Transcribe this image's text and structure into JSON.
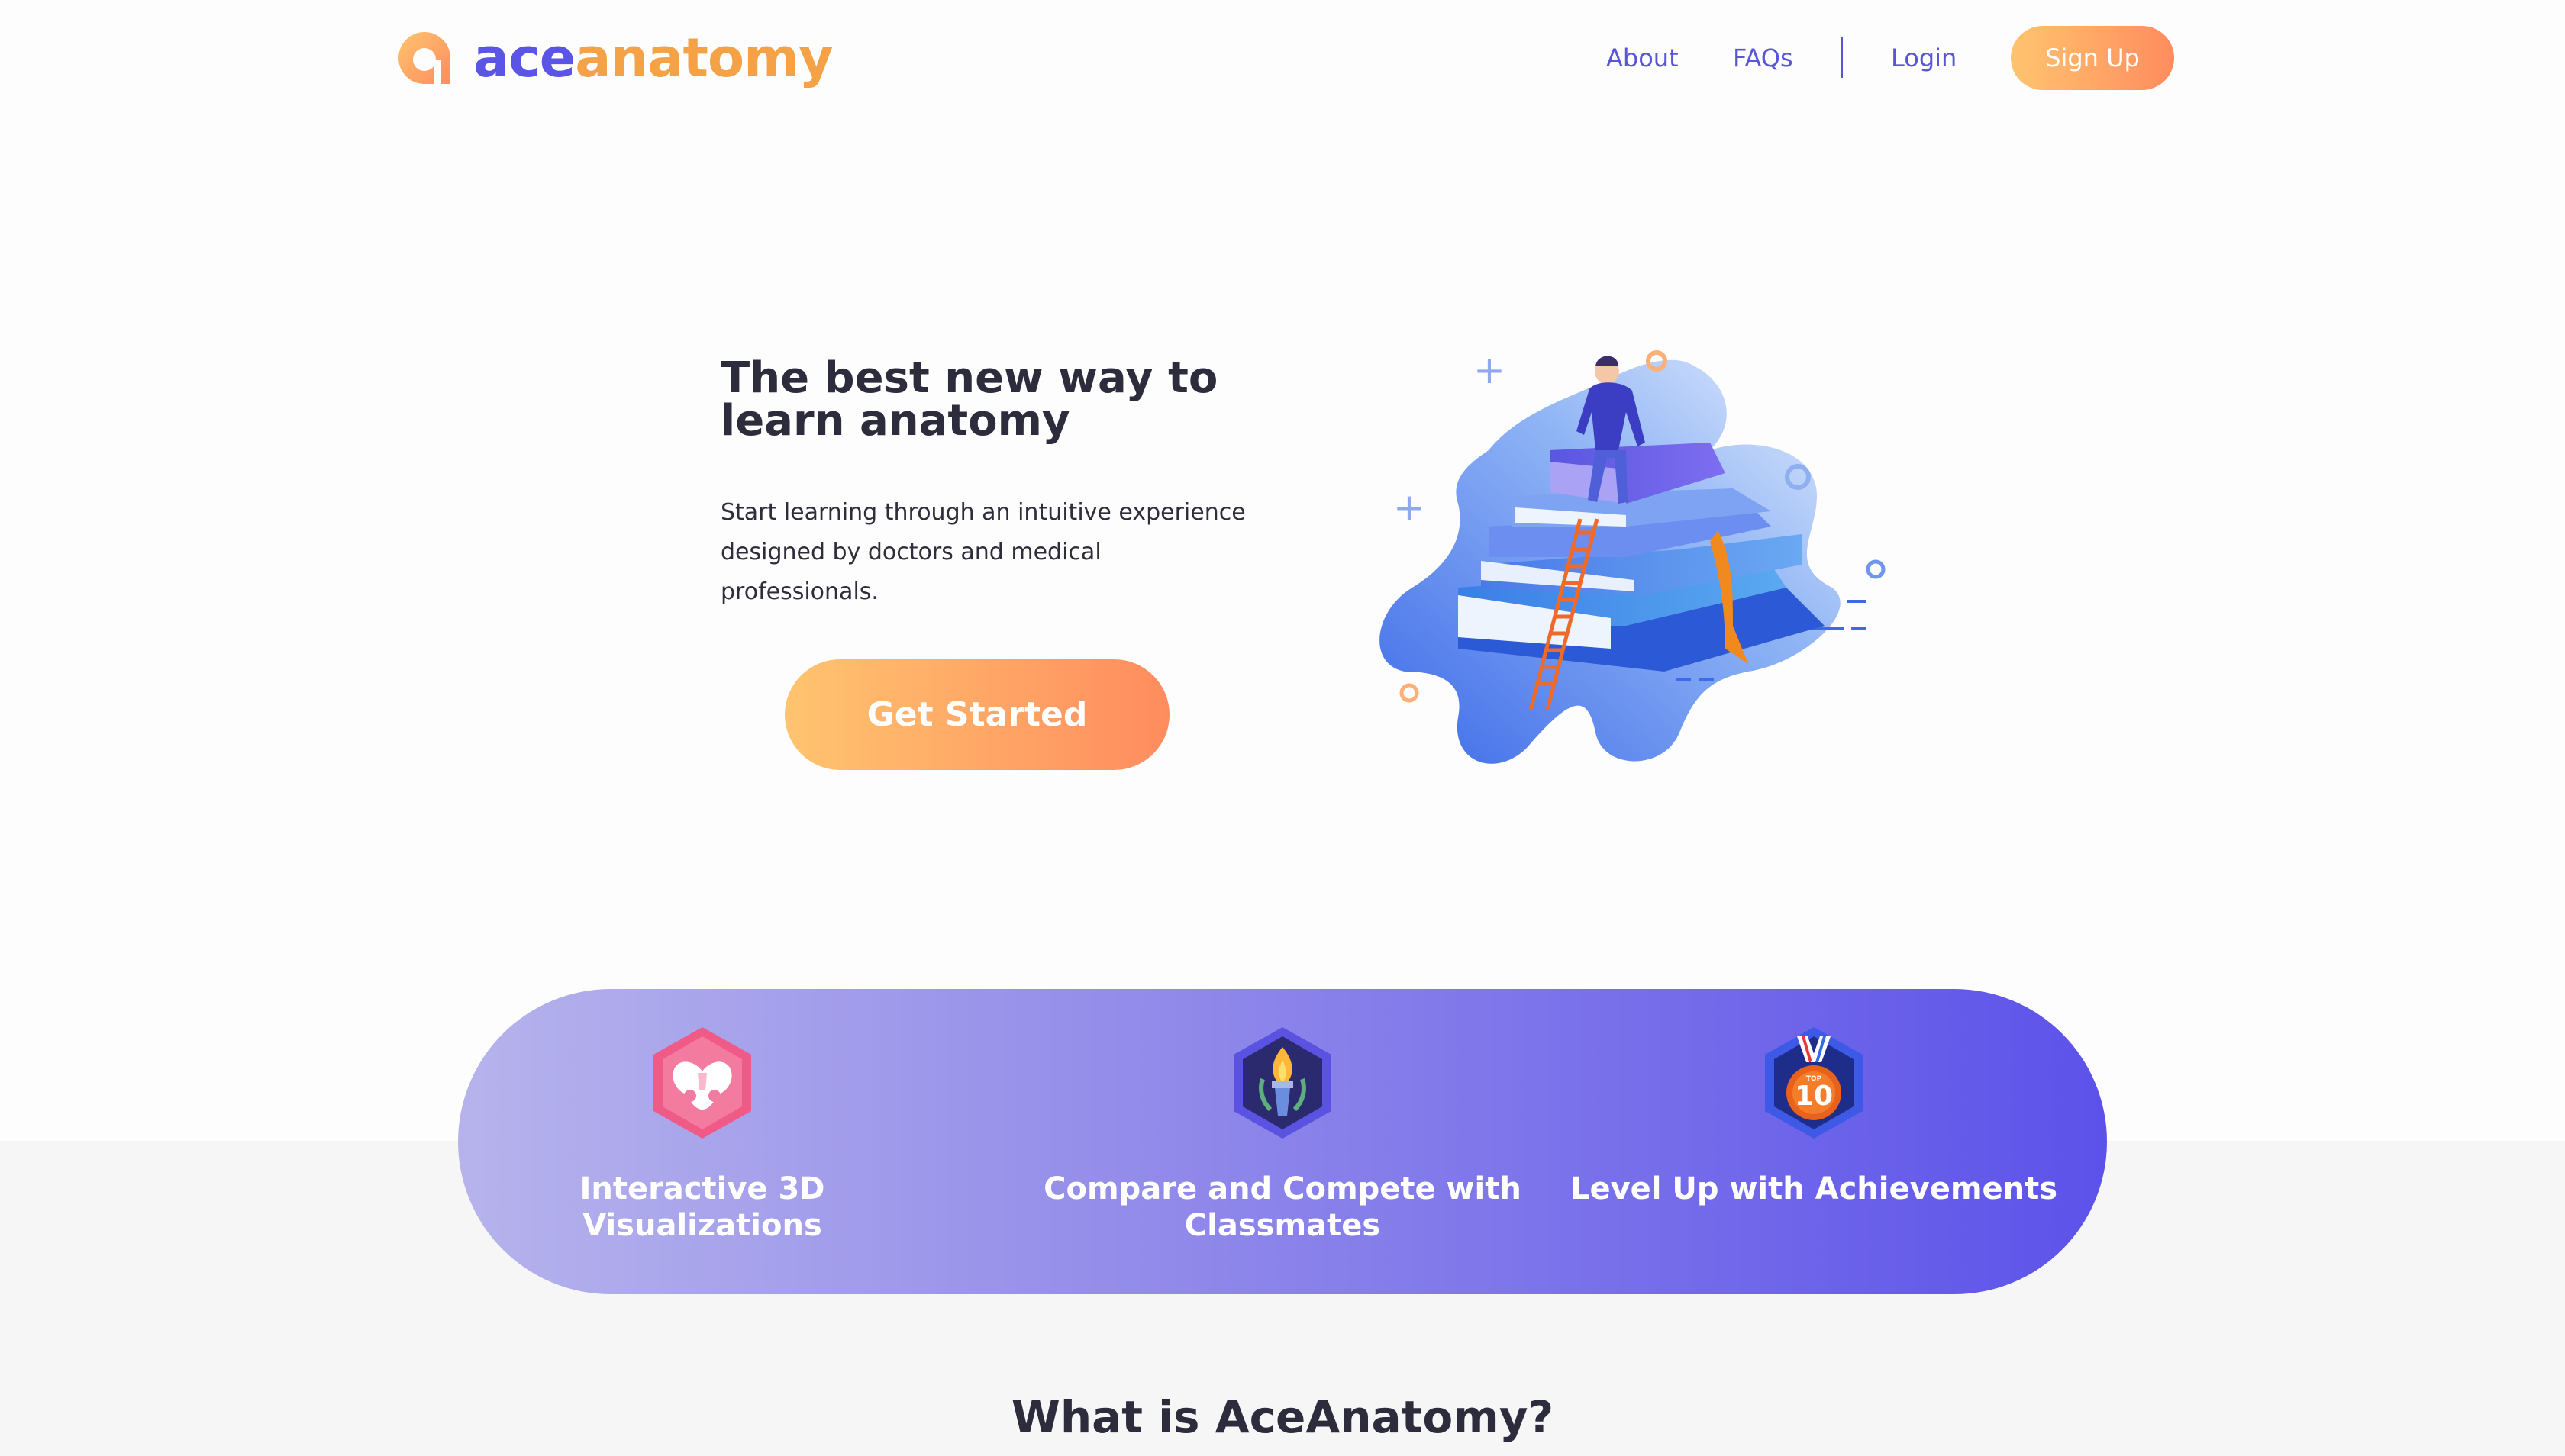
{
  "brand": {
    "name_part1": "ace",
    "name_part2": "anatomy",
    "primary_color": "#5a55e6",
    "accent_color": "#f5a247"
  },
  "nav": {
    "about": "About",
    "faqs": "FAQs",
    "login": "Login",
    "signup": "Sign Up"
  },
  "hero": {
    "title": "The best new way to learn anatomy",
    "subtitle": "Start learning through an intuitive experience designed by doctors and medical professionals.",
    "cta": "Get Started"
  },
  "features": [
    {
      "icon": "pelvis-badge-icon",
      "label": "Interactive 3D Visualizations"
    },
    {
      "icon": "torch-badge-icon",
      "label": "Compare and Compete with Classmates"
    },
    {
      "icon": "top-10-medal-icon",
      "label": "Level Up with Achievements"
    }
  ],
  "section": {
    "title": "What is AceAnatomy?"
  },
  "medal": {
    "small_text": "TOP",
    "number": "10"
  }
}
